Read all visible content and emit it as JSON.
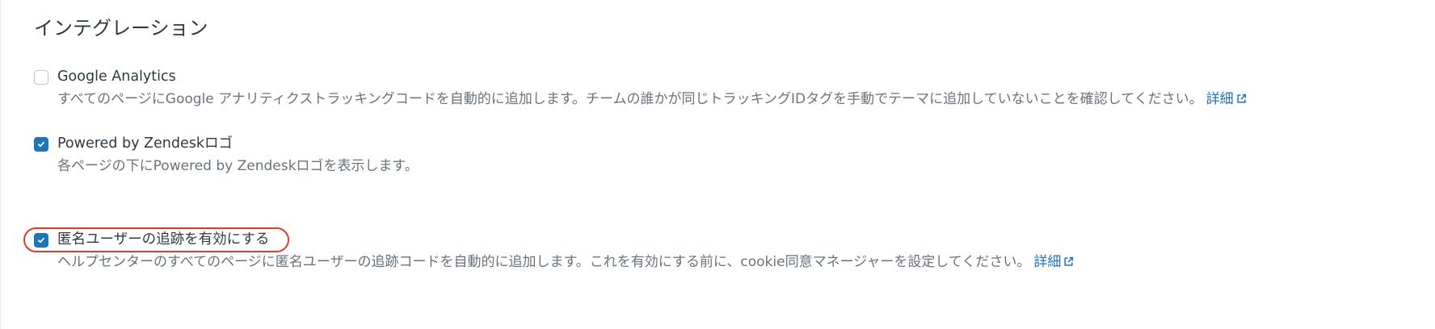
{
  "section": {
    "title": "インテグレーション"
  },
  "integrations": [
    {
      "label": "Google Analytics",
      "checked": false,
      "description": "すべてのページにGoogle アナリティクストラッキングコードを自動的に追加します。チームの誰かが同じトラッキングIDタグを手動でテーマに追加していないことを確認してください。",
      "link_label": "詳細",
      "link_icon": "external-link-icon"
    },
    {
      "label": "Powered by Zendeskロゴ",
      "checked": true,
      "description": "各ページの下にPowered by Zendeskロゴを表示します。"
    },
    {
      "label": "匿名ユーザーの追跡を有効にする",
      "checked": true,
      "highlighted": true,
      "description": "ヘルプセンターのすべてのページに匿名ユーザーの追跡コードを自動的に追加します。これを有効にする前に、cookie同意マネージャーを設定してください。",
      "link_label": "詳細",
      "link_icon": "external-link-icon"
    }
  ],
  "colors": {
    "accent": "#1f73b7",
    "text": "#2f3941",
    "muted_text": "#68737d",
    "checkbox_border": "#c2c8cc",
    "highlight": "#d93f2c"
  }
}
